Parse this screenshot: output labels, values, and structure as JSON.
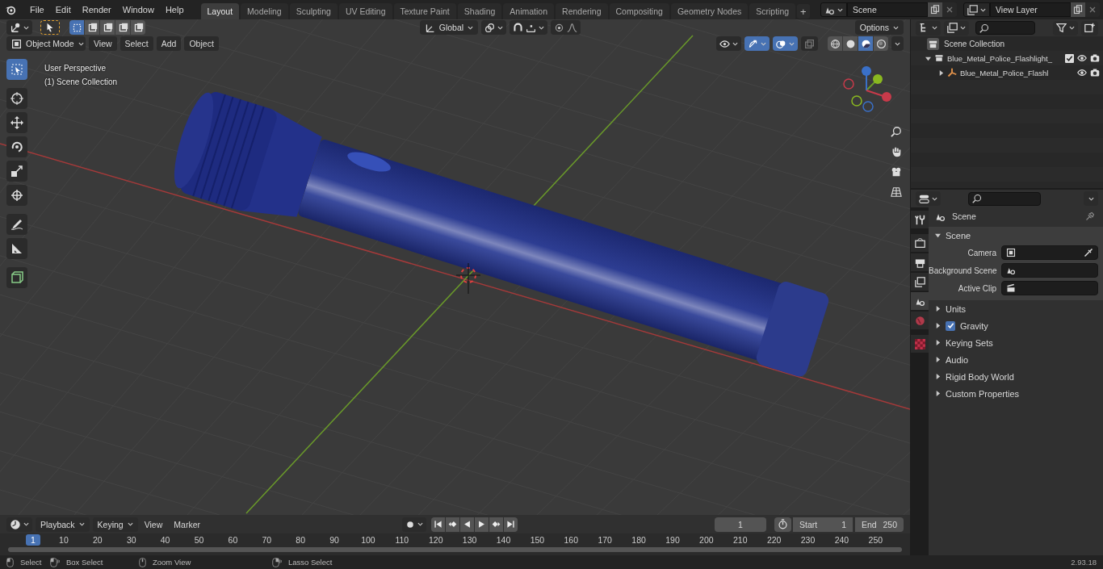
{
  "top_bar": {
    "menus": [
      "File",
      "Edit",
      "Render",
      "Window",
      "Help"
    ],
    "workspaces": [
      {
        "label": "Layout",
        "selected": true
      },
      {
        "label": "Modeling",
        "selected": false
      },
      {
        "label": "Sculpting",
        "selected": false
      },
      {
        "label": "UV Editing",
        "selected": false
      },
      {
        "label": "Texture Paint",
        "selected": false
      },
      {
        "label": "Shading",
        "selected": false
      },
      {
        "label": "Animation",
        "selected": false
      },
      {
        "label": "Rendering",
        "selected": false
      },
      {
        "label": "Compositing",
        "selected": false
      },
      {
        "label": "Geometry Nodes",
        "selected": false
      },
      {
        "label": "Scripting",
        "selected": false
      }
    ],
    "add_tab": "+",
    "scene": "Scene",
    "view_layer": "View Layer"
  },
  "viewport": {
    "orientation": "Global",
    "options": "Options",
    "mode": "Object Mode",
    "menus": [
      "View",
      "Select",
      "Add",
      "Object"
    ],
    "info": [
      "User Perspective",
      "(1) Scene Collection"
    ],
    "select_modes": [
      {
        "selected": true
      },
      {
        "selected": false
      },
      {
        "selected": false
      },
      {
        "selected": false
      },
      {
        "selected": false
      }
    ],
    "tools": [
      {
        "kind": "select",
        "selected": true
      },
      {
        "kind": "cursor",
        "selected": false
      },
      {
        "kind": "move",
        "selected": false
      },
      {
        "kind": "rotate",
        "selected": false
      },
      {
        "kind": "scale",
        "selected": false
      },
      {
        "kind": "transform",
        "selected": false
      },
      {
        "kind": "annotate",
        "selected": false
      },
      {
        "kind": "measure",
        "selected": false
      },
      {
        "kind": "add-cube",
        "selected": false
      }
    ],
    "toggles": [
      {
        "kind": "visibility",
        "on": false
      },
      {
        "kind": "gizmo",
        "on": true
      },
      {
        "kind": "overlay",
        "on": true
      },
      {
        "kind": "xray",
        "on": false
      }
    ],
    "shading": [
      {
        "kind": "wireframe",
        "selected": false
      },
      {
        "kind": "solid",
        "selected": false
      },
      {
        "kind": "material",
        "selected": true
      },
      {
        "kind": "rendered",
        "selected": false
      }
    ]
  },
  "outliner": {
    "root": "Scene Collection",
    "items": [
      {
        "label": "Blue_Metal_Police_Flashlight_",
        "kind": "collection",
        "expanded": true,
        "checked": true,
        "children": [
          {
            "label": "Blue_Metal_Police_Flashl",
            "kind": "object",
            "expanded": false
          }
        ]
      }
    ]
  },
  "properties": {
    "tabs": [
      {
        "kind": "tool",
        "selected": false
      },
      {
        "kind": "render",
        "selected": false
      },
      {
        "kind": "output",
        "selected": false
      },
      {
        "kind": "view-layer",
        "selected": false
      },
      {
        "kind": "scene",
        "selected": true
      },
      {
        "kind": "world",
        "selected": false
      },
      {
        "kind": "texture",
        "selected": false
      }
    ],
    "context": "Scene",
    "panel": {
      "title": "Scene",
      "expanded": true,
      "fields": [
        {
          "label": "Camera",
          "kind": "camera"
        },
        {
          "label": "Background Scene",
          "kind": "scene"
        },
        {
          "label": "Active Clip",
          "kind": "clip"
        }
      ]
    },
    "subpanels": [
      {
        "label": "Units",
        "kind": "plain",
        "expanded": false
      },
      {
        "label": "Gravity",
        "kind": "checkbox",
        "checked": true,
        "expanded": false
      },
      {
        "label": "Keying Sets",
        "kind": "plain",
        "expanded": false
      },
      {
        "label": "Audio",
        "kind": "plain",
        "expanded": false
      },
      {
        "label": "Rigid Body World",
        "kind": "plain",
        "expanded": false
      },
      {
        "label": "Custom Properties",
        "kind": "plain",
        "expanded": false
      }
    ]
  },
  "timeline": {
    "menus": [
      {
        "label": "Playback",
        "dropdown": true
      },
      {
        "label": "Keying",
        "dropdown": true
      },
      {
        "label": "View",
        "dropdown": false
      },
      {
        "label": "Marker",
        "dropdown": false
      }
    ],
    "current_frame": "1",
    "start_label": "Start",
    "start": "1",
    "end_label": "End",
    "end": "250",
    "playhead": "1",
    "ruler": [
      "10",
      "20",
      "30",
      "40",
      "50",
      "60",
      "70",
      "80",
      "90",
      "100",
      "110",
      "120",
      "130",
      "140",
      "150",
      "160",
      "170",
      "180",
      "190",
      "200",
      "210",
      "220",
      "230",
      "240",
      "250"
    ]
  },
  "status_bar": {
    "hints": [
      {
        "kind": "left-click",
        "label": "Select"
      },
      {
        "kind": "left-drag",
        "label": "Box Select"
      },
      {
        "kind": "middle-click",
        "label": "Zoom View"
      },
      {
        "kind": "right-drag",
        "label": "Lasso Select"
      }
    ],
    "version": "2.93.18"
  }
}
